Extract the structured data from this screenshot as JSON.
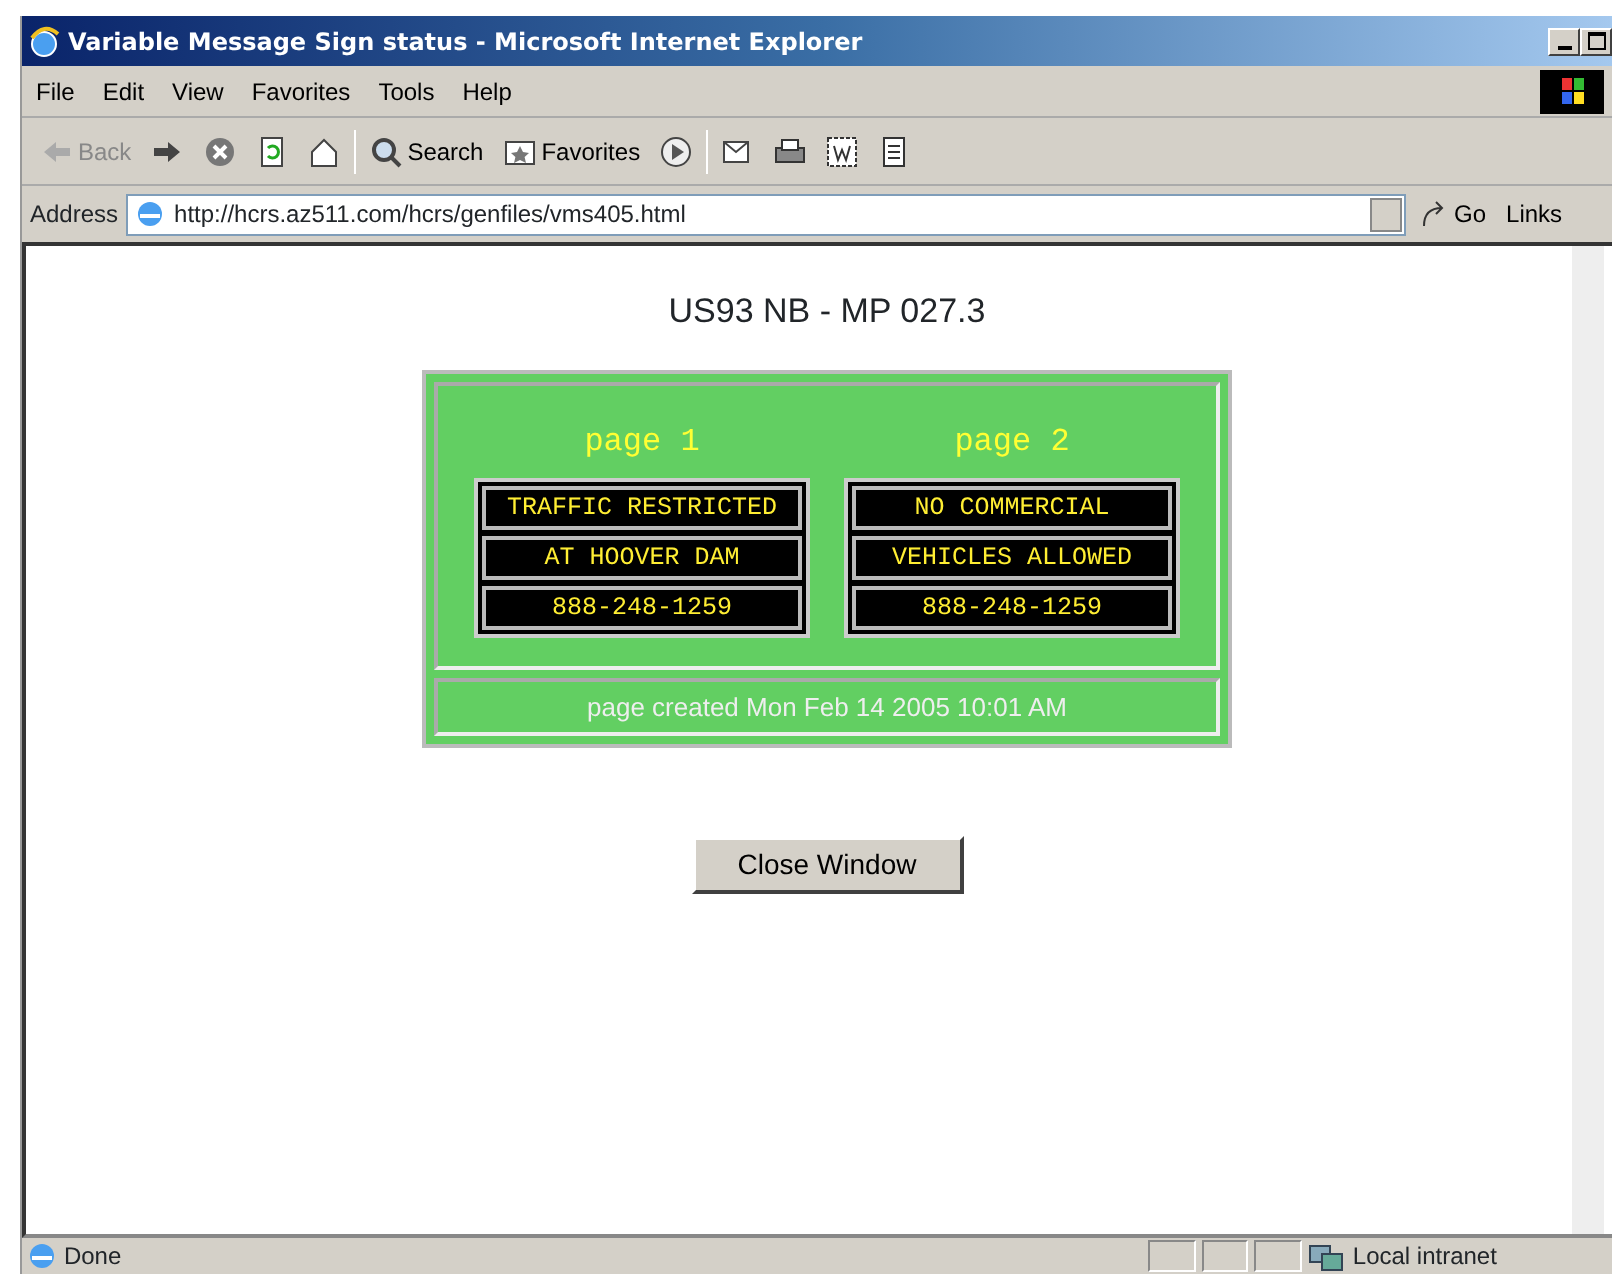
{
  "window": {
    "title": "Variable Message Sign status - Microsoft Internet Explorer"
  },
  "menu": [
    "File",
    "Edit",
    "View",
    "Favorites",
    "Tools",
    "Help"
  ],
  "toolbar": [
    {
      "kind": "back",
      "label": "Back",
      "disabled": true
    },
    {
      "kind": "forward",
      "disabled": false
    },
    {
      "kind": "stop"
    },
    {
      "kind": "refresh"
    },
    {
      "kind": "home"
    },
    {
      "kind": "search",
      "label": "Search"
    },
    {
      "kind": "favorites",
      "label": "Favorites"
    },
    {
      "kind": "media"
    },
    {
      "kind": "mail"
    },
    {
      "kind": "print"
    },
    {
      "kind": "edit"
    },
    {
      "kind": "discuss"
    }
  ],
  "address_bar": {
    "label": "Address",
    "url": "http://hcrs.az511.com/hcrs/genfiles/vms405.html",
    "go": "Go",
    "links": "Links"
  },
  "content": {
    "heading": "US93 NB - MP 027.3",
    "pages": [
      {
        "title": "page 1",
        "lines": [
          "TRAFFIC RESTRICTED",
          "AT HOOVER DAM",
          "888-248-1259"
        ]
      },
      {
        "title": "page 2",
        "lines": [
          "NO COMMERCIAL",
          "VEHICLES ALLOWED",
          "888-248-1259"
        ]
      }
    ],
    "created": "page created Mon Feb 14 2005 10:01 AM",
    "button": "Close Window"
  },
  "status_bar": {
    "text": "Done",
    "zone": "Local intranet"
  }
}
